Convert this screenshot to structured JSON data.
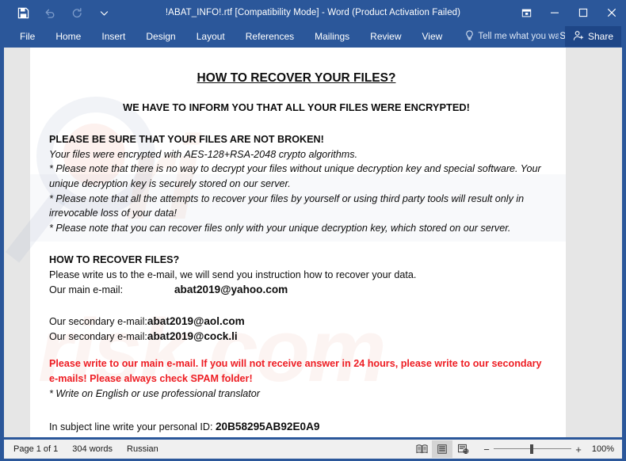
{
  "window": {
    "title": "!ABAT_INFO!.rtf [Compatibility Mode] - Word (Product Activation Failed)",
    "quick_access": [
      {
        "name": "save",
        "label": "Save",
        "enabled": true
      },
      {
        "name": "undo",
        "label": "Undo",
        "enabled": false
      },
      {
        "name": "redo",
        "label": "Redo",
        "enabled": false
      },
      {
        "name": "customize",
        "label": "Customize Quick Access Toolbar",
        "enabled": true
      }
    ],
    "controls": [
      {
        "name": "ribbon-display-options",
        "label": "Ribbon Display Options"
      },
      {
        "name": "minimize",
        "label": "Minimize"
      },
      {
        "name": "restore",
        "label": "Restore Down"
      },
      {
        "name": "close",
        "label": "Close"
      }
    ]
  },
  "ribbon": {
    "tabs": [
      {
        "label": "File"
      },
      {
        "label": "Home"
      },
      {
        "label": "Insert"
      },
      {
        "label": "Design"
      },
      {
        "label": "Layout"
      },
      {
        "label": "References"
      },
      {
        "label": "Mailings"
      },
      {
        "label": "Review"
      },
      {
        "label": "View"
      }
    ],
    "tell_me": "Tell me what you wan",
    "sign_in": "Sign in",
    "share": "Share"
  },
  "document": {
    "heading": "HOW TO RECOVER YOUR FILES?",
    "subheading": "WE HAVE TO INFORM YOU THAT ALL YOUR FILES WERE ENCRYPTED!",
    "section1_title": "PLEASE BE SURE THAT YOUR FILES ARE NOT BROKEN!",
    "line_algo": "Your files were encrypted with AES-128+RSA-2048 crypto algorithms.",
    "note1": "* Please note that there is no way to decrypt your files without unique decryption key and special software. Your unique decryption key is securely stored on our server.",
    "note2": "* Please note that all the attempts to recover your files by yourself or using third party tools will result only in irrevocable loss of your data!",
    "note3": "* Please note that you can recover files only with your unique decryption key, which stored on our server.",
    "section2_title": "HOW TO RECOVER FILES?",
    "write_us": "Please write us to the e-mail, we will send you instruction how to recover your data.",
    "main_email_label": "Our main e-mail:",
    "main_email": "abat2019@yahoo.com",
    "secondary_email_label_1": "Our secondary e-mail:",
    "secondary_email_1": "abat2019@aol.com",
    "secondary_email_label_2": "Our secondary e-mail:",
    "secondary_email_2": "abat2019@cock.li",
    "warning": "Please write to our main e-mail. If you will not receive answer in 24 hours, please write to our secondary e-mails! Please always check SPAM folder!",
    "translator_note": "* Write on English or use professional translator",
    "id_label": "In subject line write your personal ID:",
    "personal_id": "20B58295AB92E0A9",
    "warning_color": "#ee1d23"
  },
  "status_bar": {
    "page": "Page 1 of 1",
    "words": "304 words",
    "language": "Russian",
    "views": [
      {
        "name": "read-mode",
        "label": "Read Mode",
        "active": false
      },
      {
        "name": "print-layout",
        "label": "Print Layout",
        "active": true
      },
      {
        "name": "web-layout",
        "label": "Web Layout",
        "active": false
      }
    ],
    "zoom_out": "−",
    "zoom_in": "+",
    "zoom_level": "100%"
  },
  "theme": {
    "chrome_blue": "#2b579a",
    "share_blue": "#1e4687",
    "canvas_gray": "#e6e6e6",
    "status_gray": "#f0f0f0"
  }
}
